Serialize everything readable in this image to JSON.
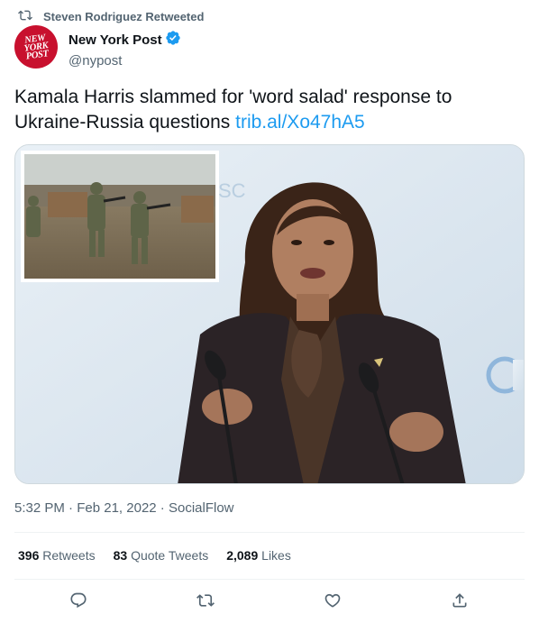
{
  "retweet": {
    "label": "Steven Rodriguez Retweeted",
    "icon": "retweet-icon"
  },
  "author": {
    "display_name": "New York Post",
    "handle": "@nypost",
    "verified": true,
    "avatar_text": [
      "NEW",
      "YORK",
      "POST"
    ],
    "avatar_color": "#c8102e"
  },
  "tweet": {
    "text": "Kamala Harris slammed for 'word salad' response to Ukraine-Russia questions",
    "link": "trib.al/Xo47hA5"
  },
  "meta": {
    "time": "5:32 PM",
    "separator": "·",
    "date": "Feb 21, 2022",
    "source": "SocialFlow"
  },
  "stats": [
    {
      "count": "396",
      "label": "Retweets"
    },
    {
      "count": "83",
      "label": "Quote Tweets"
    },
    {
      "count": "2,089",
      "label": "Likes"
    }
  ],
  "actions": [
    {
      "name": "reply-button",
      "icon": "reply-icon"
    },
    {
      "name": "retweet-button",
      "icon": "retweet-icon"
    },
    {
      "name": "like-button",
      "icon": "heart-icon"
    },
    {
      "name": "share-button",
      "icon": "share-icon"
    }
  ],
  "colors": {
    "link": "#1d9bf0",
    "secondary_text": "#536471",
    "primary_text": "#0f1419",
    "verified": "#1d9bf0"
  }
}
